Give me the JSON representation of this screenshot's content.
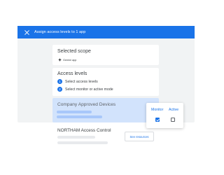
{
  "dialog": {
    "title": "Assign access levels to 1 app",
    "close_icon": "close-icon"
  },
  "scope": {
    "heading": "Selected scope",
    "app_label": "Gemini app",
    "app_icon": "app-icon"
  },
  "access": {
    "heading": "Access levels",
    "steps": [
      {
        "number": "1",
        "label": "Select access levels"
      },
      {
        "number": "2",
        "label": "Select monitor or active mode"
      }
    ]
  },
  "levels": [
    {
      "name": "Company Approved Devices",
      "selected": true
    },
    {
      "name": "NORTHAM Access Control",
      "selected": false
    }
  ],
  "permissions": {
    "monitor_label": "Monitor",
    "active_label": "Active",
    "monitor_checked": true,
    "active_checked": false
  },
  "resources_button": "See resources",
  "colors": {
    "accent": "#1a73e8",
    "selected_bg": "#d2e3fc",
    "panel_bg": "#f1f3f4"
  }
}
